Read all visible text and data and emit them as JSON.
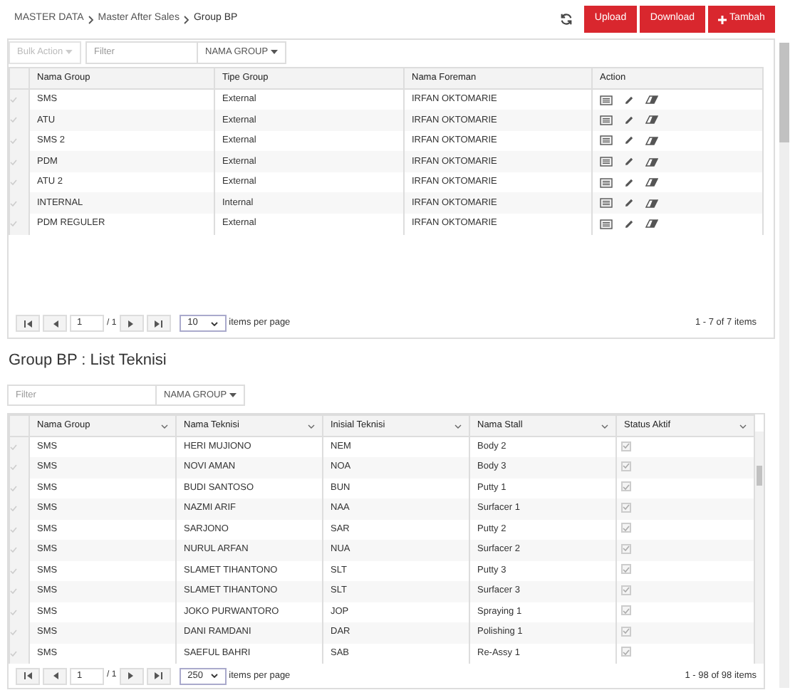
{
  "breadcrumb": [
    "MASTER DATA",
    "Master After Sales",
    "Group BP"
  ],
  "header_buttons": [
    {
      "kind": "upload",
      "label": "Upload"
    },
    {
      "kind": "download",
      "label": "Download"
    },
    {
      "kind": "add",
      "label": "Tambah"
    }
  ],
  "group_panel": {
    "bulk_action": "Bulk Action",
    "filter_placeholder": "Filter",
    "filter_field": "NAMA GROUP",
    "columns": [
      "Nama Group",
      "Tipe Group",
      "Nama Foreman",
      "Action"
    ],
    "rows": [
      {
        "cells": [
          "SMS",
          "External",
          "IRFAN OKTOMARIE"
        ]
      },
      {
        "cells": [
          "ATU",
          "External",
          "IRFAN OKTOMARIE"
        ]
      },
      {
        "cells": [
          "SMS 2",
          "External",
          "IRFAN OKTOMARIE"
        ]
      },
      {
        "cells": [
          "PDM",
          "External",
          "IRFAN OKTOMARIE"
        ]
      },
      {
        "cells": [
          "ATU 2",
          "External",
          "IRFAN OKTOMARIE"
        ]
      },
      {
        "cells": [
          "INTERNAL",
          "Internal",
          "IRFAN OKTOMARIE"
        ]
      },
      {
        "cells": [
          "PDM REGULER",
          "External",
          "IRFAN OKTOMARIE"
        ]
      }
    ],
    "pager": {
      "page": "1",
      "of": "/ 1",
      "page_size": "10",
      "per_page_label": "items per page",
      "summary": "1 - 7 of 7 items"
    }
  },
  "list_title": "Group BP : List Teknisi",
  "list_panel": {
    "filter_placeholder": "Filter",
    "filter_field": "NAMA GROUP",
    "columns": [
      "Nama Group",
      "Nama Teknisi",
      "Inisial Teknisi",
      "Nama Stall",
      "Status Aktif"
    ],
    "rows": [
      {
        "cells": [
          "SMS",
          "HERI MUJIONO",
          "NEM",
          "Body 2"
        ],
        "active": true
      },
      {
        "cells": [
          "SMS",
          "NOVI AMAN",
          "NOA",
          "Body 3"
        ],
        "active": true
      },
      {
        "cells": [
          "SMS",
          "BUDI SANTOSO",
          "BUN",
          "Putty 1"
        ],
        "active": true
      },
      {
        "cells": [
          "SMS",
          "NAZMI ARIF",
          "NAA",
          "Surfacer 1"
        ],
        "active": true
      },
      {
        "cells": [
          "SMS",
          "SARJONO",
          "SAR",
          "Putty 2"
        ],
        "active": true
      },
      {
        "cells": [
          "SMS",
          "NURUL ARFAN",
          "NUA",
          "Surfacer 2"
        ],
        "active": true
      },
      {
        "cells": [
          "SMS",
          "SLAMET TIHANTONO",
          "SLT",
          "Putty 3"
        ],
        "active": true
      },
      {
        "cells": [
          "SMS",
          "SLAMET TIHANTONO",
          "SLT",
          "Surfacer 3"
        ],
        "active": true
      },
      {
        "cells": [
          "SMS",
          "JOKO PURWANTORO",
          "JOP",
          "Spraying 1"
        ],
        "active": true
      },
      {
        "cells": [
          "SMS",
          "DANI RAMDANI",
          "DAR",
          "Polishing 1"
        ],
        "active": true
      },
      {
        "cells": [
          "SMS",
          "SAEFUL BAHRI",
          "SAB",
          "Re-Assy 1"
        ],
        "active": true
      }
    ],
    "pager": {
      "page": "1",
      "of": "/ 1",
      "page_size": "250",
      "per_page_label": "items per page",
      "summary": "1 - 98 of 98 items"
    }
  }
}
